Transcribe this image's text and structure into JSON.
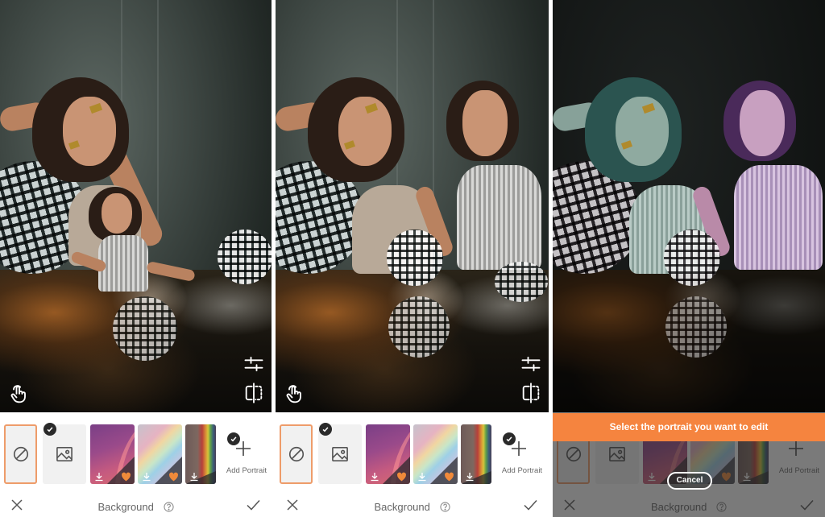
{
  "panels": [
    {
      "id": "before",
      "thumbnails": {
        "none_label": "no-background",
        "image_label": "custom-image-background",
        "backgrounds": [
          "pink-rainbow",
          "pastel-rainbow",
          "vivid-rainbow"
        ]
      },
      "add_portrait_label": "Add Portrait",
      "toolbar": {
        "title": "Background"
      }
    },
    {
      "id": "after",
      "add_portrait_label": "Add Portrait",
      "toolbar": {
        "title": "Background"
      }
    },
    {
      "id": "select-portrait",
      "add_portrait_label": "Add Portrait",
      "toolbar": {
        "title": "Background"
      },
      "banner_text": "Select the portrait you want to edit",
      "cancel_label": "Cancel"
    }
  ],
  "icons": {
    "touch": "touch-gesture-icon",
    "adjust": "adjust-sliders-icon",
    "compare": "compare-split-icon",
    "none": "prohibited-icon",
    "image": "image-icon",
    "download": "download-icon",
    "favorite": "heart-icon",
    "add": "plus-icon",
    "check": "check-badge-icon",
    "close": "close-icon",
    "confirm": "checkmark-icon",
    "help": "help-icon"
  },
  "colors": {
    "accent": "#f5843f",
    "selected_border": "#ee9c6a",
    "heart": "#f08a3a"
  }
}
